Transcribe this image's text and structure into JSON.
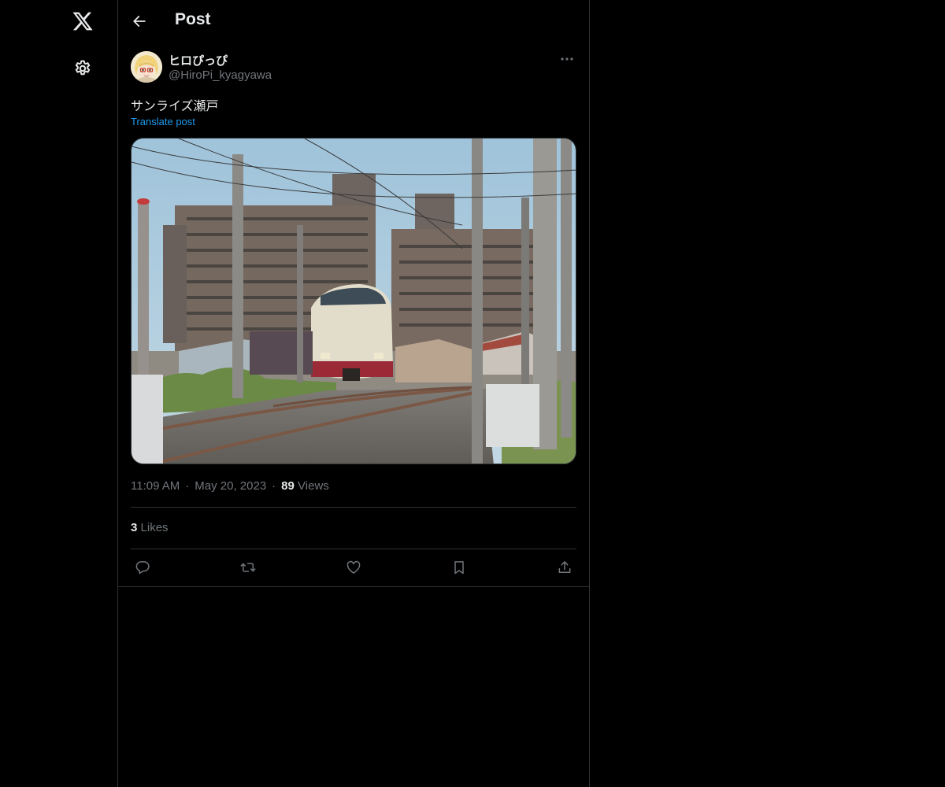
{
  "header": {
    "title": "Post"
  },
  "author": {
    "name": "ヒロぴっぴ",
    "handle": "@HiroPi_kyagyawa"
  },
  "post": {
    "text": "サンライズ瀬戸",
    "translate_label": "Translate post",
    "time": "11:09 AM",
    "date": "May 20, 2023",
    "separator": "·",
    "views_count": "89",
    "views_label": "Views",
    "likes_count": "3",
    "likes_label": "Likes"
  },
  "icons": {
    "logo": "x-logo-icon",
    "settings": "gear-icon",
    "back": "arrow-left-icon",
    "more": "more-dots-icon",
    "reply": "reply-icon",
    "repost": "repost-icon",
    "like": "heart-icon",
    "bookmark": "bookmark-icon",
    "share": "share-icon"
  },
  "colors": {
    "background": "#000000",
    "text_primary": "#e7e9ea",
    "text_secondary": "#71767b",
    "accent": "#1d9bf0",
    "border": "#2f3336"
  }
}
